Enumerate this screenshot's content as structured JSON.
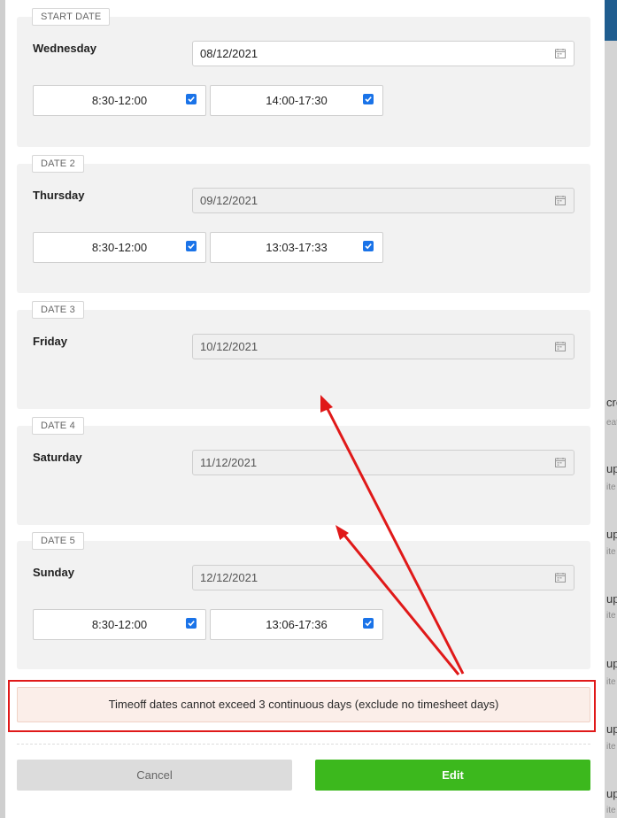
{
  "backdrop_fragments": [
    {
      "text": "cre",
      "kind": "main"
    },
    {
      "text": "eat",
      "kind": "sub"
    },
    {
      "text": "up",
      "kind": "main"
    },
    {
      "text": "ite",
      "kind": "sub"
    },
    {
      "text": "up",
      "kind": "main"
    },
    {
      "text": "ite",
      "kind": "sub"
    },
    {
      "text": "up",
      "kind": "main"
    },
    {
      "text": "ite",
      "kind": "sub"
    },
    {
      "text": "up",
      "kind": "main"
    },
    {
      "text": "ite",
      "kind": "sub"
    },
    {
      "text": "up",
      "kind": "main"
    },
    {
      "text": "ite",
      "kind": "sub"
    },
    {
      "text": "up",
      "kind": "main"
    },
    {
      "text": "ite",
      "kind": "sub"
    }
  ],
  "dates": [
    {
      "tag": "START DATE",
      "day": "Wednesday",
      "date": "08/12/2021",
      "disabled": false,
      "slots": [
        {
          "label": "8:30-12:00",
          "checked": true
        },
        {
          "label": "14:00-17:30",
          "checked": true
        }
      ]
    },
    {
      "tag": "DATE 2",
      "day": "Thursday",
      "date": "09/12/2021",
      "disabled": true,
      "slots": [
        {
          "label": "8:30-12:00",
          "checked": true
        },
        {
          "label": "13:03-17:33",
          "checked": true
        }
      ]
    },
    {
      "tag": "DATE 3",
      "day": "Friday",
      "date": "10/12/2021",
      "disabled": true,
      "slots": []
    },
    {
      "tag": "DATE 4",
      "day": "Saturday",
      "date": "11/12/2021",
      "disabled": true,
      "slots": []
    },
    {
      "tag": "DATE 5",
      "day": "Sunday",
      "date": "12/12/2021",
      "disabled": true,
      "slots": [
        {
          "label": "8:30-12:00",
          "checked": true
        },
        {
          "label": "13:06-17:36",
          "checked": true
        }
      ]
    }
  ],
  "error_message": "Timeoff dates cannot exceed 3 continuous days (exclude no timesheet days)",
  "buttons": {
    "cancel": "Cancel",
    "edit": "Edit"
  },
  "icons": {
    "date_picker": "calendar-icon",
    "slot_check": "checkbox-checked-icon"
  },
  "colors": {
    "checkbox": "#1a73e8",
    "edit_button": "#3cb81d",
    "cancel_button": "#dcdcdc",
    "error_background": "#fbeee9",
    "annotation": "#e01919"
  }
}
